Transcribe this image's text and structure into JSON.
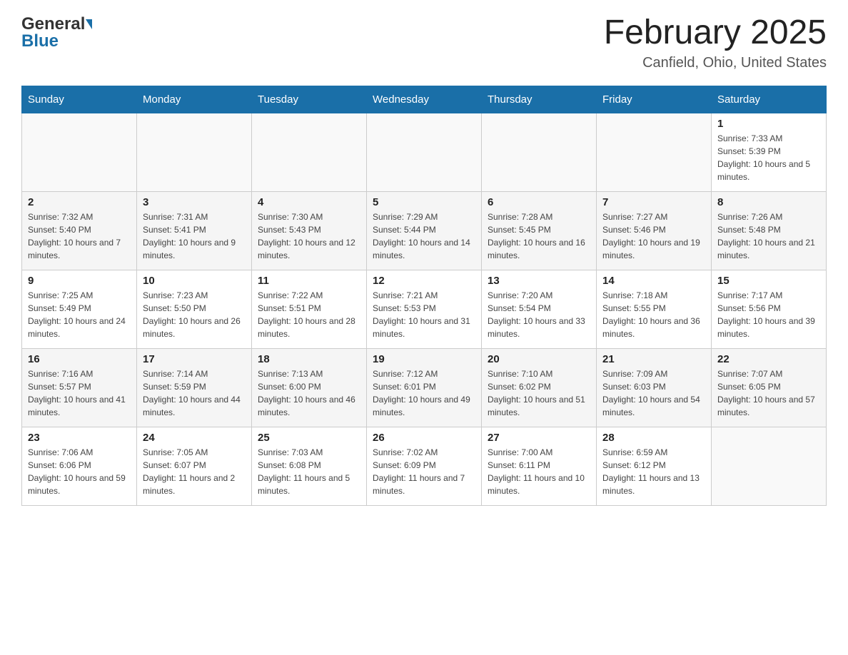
{
  "header": {
    "logo": {
      "general": "General",
      "blue": "Blue",
      "arrow": "▶"
    },
    "title": "February 2025",
    "location": "Canfield, Ohio, United States"
  },
  "calendar": {
    "days": [
      "Sunday",
      "Monday",
      "Tuesday",
      "Wednesday",
      "Thursday",
      "Friday",
      "Saturday"
    ],
    "weeks": [
      [
        {
          "day": "",
          "info": ""
        },
        {
          "day": "",
          "info": ""
        },
        {
          "day": "",
          "info": ""
        },
        {
          "day": "",
          "info": ""
        },
        {
          "day": "",
          "info": ""
        },
        {
          "day": "",
          "info": ""
        },
        {
          "day": "1",
          "info": "Sunrise: 7:33 AM\nSunset: 5:39 PM\nDaylight: 10 hours and 5 minutes."
        }
      ],
      [
        {
          "day": "2",
          "info": "Sunrise: 7:32 AM\nSunset: 5:40 PM\nDaylight: 10 hours and 7 minutes."
        },
        {
          "day": "3",
          "info": "Sunrise: 7:31 AM\nSunset: 5:41 PM\nDaylight: 10 hours and 9 minutes."
        },
        {
          "day": "4",
          "info": "Sunrise: 7:30 AM\nSunset: 5:43 PM\nDaylight: 10 hours and 12 minutes."
        },
        {
          "day": "5",
          "info": "Sunrise: 7:29 AM\nSunset: 5:44 PM\nDaylight: 10 hours and 14 minutes."
        },
        {
          "day": "6",
          "info": "Sunrise: 7:28 AM\nSunset: 5:45 PM\nDaylight: 10 hours and 16 minutes."
        },
        {
          "day": "7",
          "info": "Sunrise: 7:27 AM\nSunset: 5:46 PM\nDaylight: 10 hours and 19 minutes."
        },
        {
          "day": "8",
          "info": "Sunrise: 7:26 AM\nSunset: 5:48 PM\nDaylight: 10 hours and 21 minutes."
        }
      ],
      [
        {
          "day": "9",
          "info": "Sunrise: 7:25 AM\nSunset: 5:49 PM\nDaylight: 10 hours and 24 minutes."
        },
        {
          "day": "10",
          "info": "Sunrise: 7:23 AM\nSunset: 5:50 PM\nDaylight: 10 hours and 26 minutes."
        },
        {
          "day": "11",
          "info": "Sunrise: 7:22 AM\nSunset: 5:51 PM\nDaylight: 10 hours and 28 minutes."
        },
        {
          "day": "12",
          "info": "Sunrise: 7:21 AM\nSunset: 5:53 PM\nDaylight: 10 hours and 31 minutes."
        },
        {
          "day": "13",
          "info": "Sunrise: 7:20 AM\nSunset: 5:54 PM\nDaylight: 10 hours and 33 minutes."
        },
        {
          "day": "14",
          "info": "Sunrise: 7:18 AM\nSunset: 5:55 PM\nDaylight: 10 hours and 36 minutes."
        },
        {
          "day": "15",
          "info": "Sunrise: 7:17 AM\nSunset: 5:56 PM\nDaylight: 10 hours and 39 minutes."
        }
      ],
      [
        {
          "day": "16",
          "info": "Sunrise: 7:16 AM\nSunset: 5:57 PM\nDaylight: 10 hours and 41 minutes."
        },
        {
          "day": "17",
          "info": "Sunrise: 7:14 AM\nSunset: 5:59 PM\nDaylight: 10 hours and 44 minutes."
        },
        {
          "day": "18",
          "info": "Sunrise: 7:13 AM\nSunset: 6:00 PM\nDaylight: 10 hours and 46 minutes."
        },
        {
          "day": "19",
          "info": "Sunrise: 7:12 AM\nSunset: 6:01 PM\nDaylight: 10 hours and 49 minutes."
        },
        {
          "day": "20",
          "info": "Sunrise: 7:10 AM\nSunset: 6:02 PM\nDaylight: 10 hours and 51 minutes."
        },
        {
          "day": "21",
          "info": "Sunrise: 7:09 AM\nSunset: 6:03 PM\nDaylight: 10 hours and 54 minutes."
        },
        {
          "day": "22",
          "info": "Sunrise: 7:07 AM\nSunset: 6:05 PM\nDaylight: 10 hours and 57 minutes."
        }
      ],
      [
        {
          "day": "23",
          "info": "Sunrise: 7:06 AM\nSunset: 6:06 PM\nDaylight: 10 hours and 59 minutes."
        },
        {
          "day": "24",
          "info": "Sunrise: 7:05 AM\nSunset: 6:07 PM\nDaylight: 11 hours and 2 minutes."
        },
        {
          "day": "25",
          "info": "Sunrise: 7:03 AM\nSunset: 6:08 PM\nDaylight: 11 hours and 5 minutes."
        },
        {
          "day": "26",
          "info": "Sunrise: 7:02 AM\nSunset: 6:09 PM\nDaylight: 11 hours and 7 minutes."
        },
        {
          "day": "27",
          "info": "Sunrise: 7:00 AM\nSunset: 6:11 PM\nDaylight: 11 hours and 10 minutes."
        },
        {
          "day": "28",
          "info": "Sunrise: 6:59 AM\nSunset: 6:12 PM\nDaylight: 11 hours and 13 minutes."
        },
        {
          "day": "",
          "info": ""
        }
      ]
    ]
  }
}
